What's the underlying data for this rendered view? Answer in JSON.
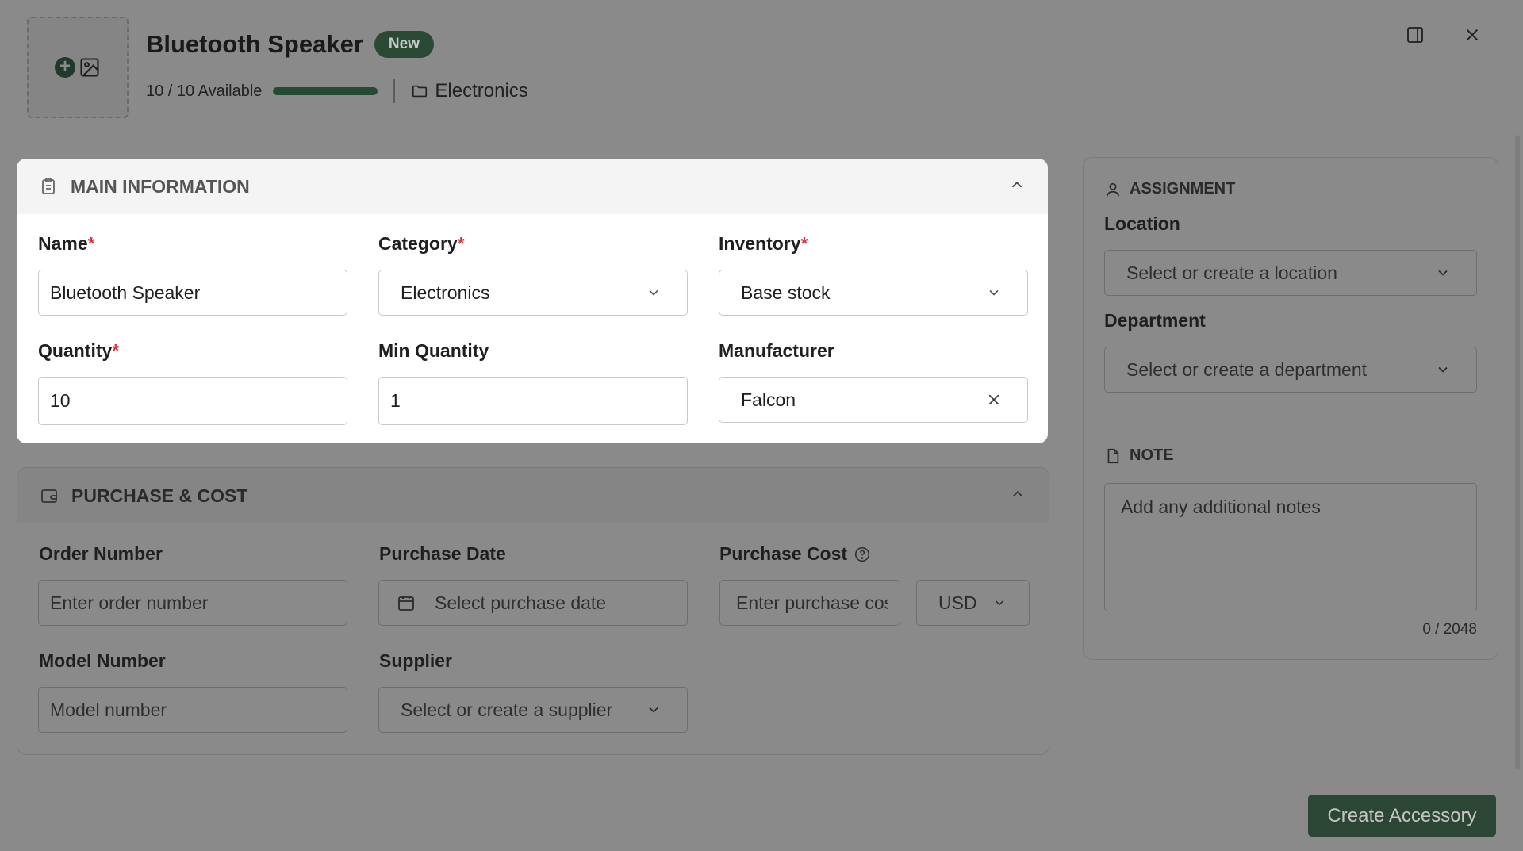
{
  "header": {
    "title": "Bluetooth Speaker",
    "badge": "New",
    "availability": "10 / 10 Available",
    "availability_fraction": 1.0,
    "category": "Electronics"
  },
  "main_info": {
    "section_title": "MAIN INFORMATION",
    "name_label": "Name",
    "name_value": "Bluetooth Speaker",
    "category_label": "Category",
    "category_value": "Electronics",
    "inventory_label": "Inventory",
    "inventory_value": "Base stock",
    "quantity_label": "Quantity",
    "quantity_value": "10",
    "min_quantity_label": "Min Quantity",
    "min_quantity_value": "1",
    "manufacturer_label": "Manufacturer",
    "manufacturer_value": "Falcon",
    "required_mark": "*"
  },
  "purchase": {
    "section_title": "PURCHASE & COST",
    "order_number_label": "Order Number",
    "order_number_placeholder": "Enter order number",
    "purchase_date_label": "Purchase Date",
    "purchase_date_placeholder": "Select purchase date",
    "purchase_cost_label": "Purchase Cost",
    "purchase_cost_placeholder": "Enter purchase cost",
    "currency_value": "USD",
    "model_number_label": "Model Number",
    "model_number_placeholder": "Model number",
    "supplier_label": "Supplier",
    "supplier_placeholder": "Select or create a supplier"
  },
  "assignment": {
    "section_title": "ASSIGNMENT",
    "location_label": "Location",
    "location_placeholder": "Select or create a location",
    "department_label": "Department",
    "department_placeholder": "Select or create a department"
  },
  "note": {
    "section_title": "NOTE",
    "placeholder": "Add any additional notes",
    "counter": "0 / 2048"
  },
  "footer": {
    "create_label": "Create Accessory"
  },
  "colors": {
    "brand_green": "#2b4634",
    "required_red": "#d9323a"
  }
}
